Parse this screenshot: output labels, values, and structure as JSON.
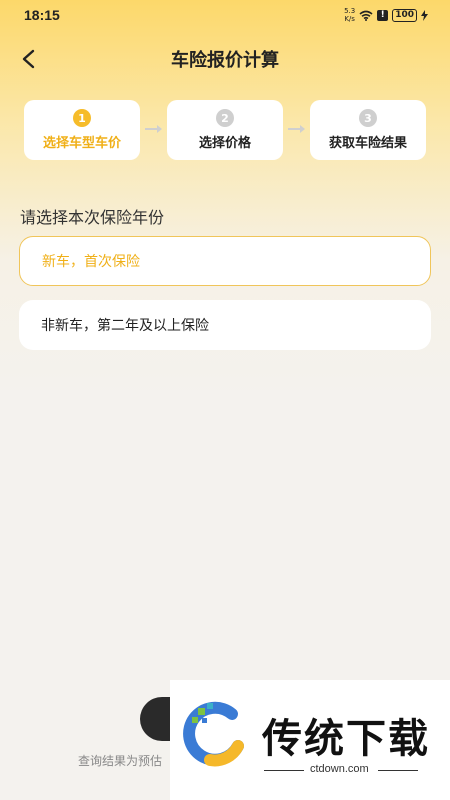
{
  "status_bar": {
    "time": "18:15",
    "speed_top": "5.3",
    "speed_bottom": "K/s",
    "battery": "100"
  },
  "header": {
    "title": "车险报价计算"
  },
  "steps": [
    {
      "number": "1",
      "label": "选择车型车价",
      "active": true
    },
    {
      "number": "2",
      "label": "选择价格",
      "active": false
    },
    {
      "number": "3",
      "label": "获取车险结果",
      "active": false
    }
  ],
  "form": {
    "question": "请选择本次保险年份",
    "options": [
      {
        "label": "新车，首次保险",
        "selected": true
      },
      {
        "label": "非新车，第二年及以上保险",
        "selected": false
      }
    ]
  },
  "footer": {
    "note": "查询结果为预估"
  },
  "watermark": {
    "brand": "传统下载",
    "url": "ctdown.com"
  },
  "colors": {
    "accent": "#f6bc2a",
    "header_gradient": "#fcd86a",
    "background": "#f4f2ee"
  }
}
